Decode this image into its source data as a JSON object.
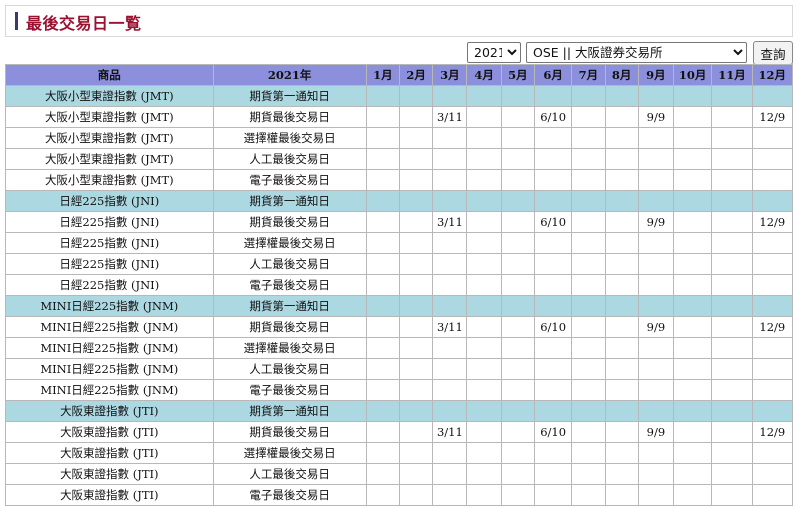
{
  "title": "最後交易日一覧",
  "controls": {
    "year_value": "2021",
    "exchange_value": "OSE || 大阪證券交易所",
    "query_label": "查詢"
  },
  "table": {
    "headers": [
      "商品",
      "2021年",
      "1月",
      "2月",
      "3月",
      "4月",
      "5月",
      "6月",
      "7月",
      "8月",
      "9月",
      "10月",
      "11月",
      "12月"
    ],
    "rows": [
      {
        "group": true,
        "product": "大阪小型東證指數 (JMT)",
        "type": "期貨第一通知日",
        "months": [
          "",
          "",
          "",
          "",
          "",
          "",
          "",
          "",
          "",
          "",
          "",
          ""
        ]
      },
      {
        "group": false,
        "product": "大阪小型東證指數 (JMT)",
        "type": "期貨最後交易日",
        "months": [
          "",
          "",
          "3/11",
          "",
          "",
          "6/10",
          "",
          "",
          "9/9",
          "",
          "",
          "12/9"
        ]
      },
      {
        "group": false,
        "product": "大阪小型東證指數 (JMT)",
        "type": "選擇權最後交易日",
        "months": [
          "",
          "",
          "",
          "",
          "",
          "",
          "",
          "",
          "",
          "",
          "",
          ""
        ]
      },
      {
        "group": false,
        "product": "大阪小型東證指數 (JMT)",
        "type": "人工最後交易日",
        "months": [
          "",
          "",
          "",
          "",
          "",
          "",
          "",
          "",
          "",
          "",
          "",
          ""
        ]
      },
      {
        "group": false,
        "product": "大阪小型東證指數 (JMT)",
        "type": "電子最後交易日",
        "months": [
          "",
          "",
          "",
          "",
          "",
          "",
          "",
          "",
          "",
          "",
          "",
          ""
        ]
      },
      {
        "group": true,
        "product": "日經225指數 (JNI)",
        "type": "期貨第一通知日",
        "months": [
          "",
          "",
          "",
          "",
          "",
          "",
          "",
          "",
          "",
          "",
          "",
          ""
        ]
      },
      {
        "group": false,
        "product": "日經225指數 (JNI)",
        "type": "期貨最後交易日",
        "months": [
          "",
          "",
          "3/11",
          "",
          "",
          "6/10",
          "",
          "",
          "9/9",
          "",
          "",
          "12/9"
        ]
      },
      {
        "group": false,
        "product": "日經225指數 (JNI)",
        "type": "選擇權最後交易日",
        "months": [
          "",
          "",
          "",
          "",
          "",
          "",
          "",
          "",
          "",
          "",
          "",
          ""
        ]
      },
      {
        "group": false,
        "product": "日經225指數 (JNI)",
        "type": "人工最後交易日",
        "months": [
          "",
          "",
          "",
          "",
          "",
          "",
          "",
          "",
          "",
          "",
          "",
          ""
        ]
      },
      {
        "group": false,
        "product": "日經225指數 (JNI)",
        "type": "電子最後交易日",
        "months": [
          "",
          "",
          "",
          "",
          "",
          "",
          "",
          "",
          "",
          "",
          "",
          ""
        ]
      },
      {
        "group": true,
        "product": "MINI日經225指數 (JNM)",
        "type": "期貨第一通知日",
        "months": [
          "",
          "",
          "",
          "",
          "",
          "",
          "",
          "",
          "",
          "",
          "",
          ""
        ]
      },
      {
        "group": false,
        "product": "MINI日經225指數 (JNM)",
        "type": "期貨最後交易日",
        "months": [
          "",
          "",
          "3/11",
          "",
          "",
          "6/10",
          "",
          "",
          "9/9",
          "",
          "",
          "12/9"
        ]
      },
      {
        "group": false,
        "product": "MINI日經225指數 (JNM)",
        "type": "選擇權最後交易日",
        "months": [
          "",
          "",
          "",
          "",
          "",
          "",
          "",
          "",
          "",
          "",
          "",
          ""
        ]
      },
      {
        "group": false,
        "product": "MINI日經225指數 (JNM)",
        "type": "人工最後交易日",
        "months": [
          "",
          "",
          "",
          "",
          "",
          "",
          "",
          "",
          "",
          "",
          "",
          ""
        ]
      },
      {
        "group": false,
        "product": "MINI日經225指數 (JNM)",
        "type": "電子最後交易日",
        "months": [
          "",
          "",
          "",
          "",
          "",
          "",
          "",
          "",
          "",
          "",
          "",
          ""
        ]
      },
      {
        "group": true,
        "product": "大阪東證指數 (JTI)",
        "type": "期貨第一通知日",
        "months": [
          "",
          "",
          "",
          "",
          "",
          "",
          "",
          "",
          "",
          "",
          "",
          ""
        ]
      },
      {
        "group": false,
        "product": "大阪東證指數 (JTI)",
        "type": "期貨最後交易日",
        "months": [
          "",
          "",
          "3/11",
          "",
          "",
          "6/10",
          "",
          "",
          "9/9",
          "",
          "",
          "12/9"
        ]
      },
      {
        "group": false,
        "product": "大阪東證指數 (JTI)",
        "type": "選擇權最後交易日",
        "months": [
          "",
          "",
          "",
          "",
          "",
          "",
          "",
          "",
          "",
          "",
          "",
          ""
        ]
      },
      {
        "group": false,
        "product": "大阪東證指數 (JTI)",
        "type": "人工最後交易日",
        "months": [
          "",
          "",
          "",
          "",
          "",
          "",
          "",
          "",
          "",
          "",
          "",
          ""
        ]
      },
      {
        "group": false,
        "product": "大阪東證指數 (JTI)",
        "type": "電子最後交易日",
        "months": [
          "",
          "",
          "",
          "",
          "",
          "",
          "",
          "",
          "",
          "",
          "",
          ""
        ]
      }
    ]
  }
}
